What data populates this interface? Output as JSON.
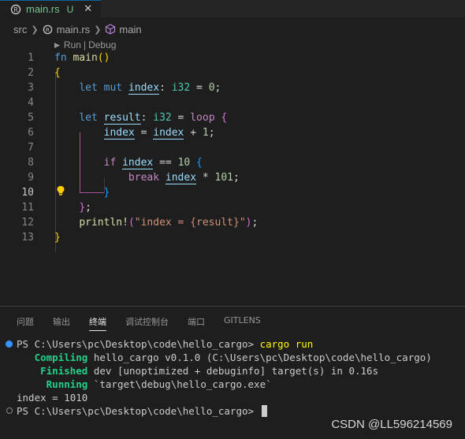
{
  "tab": {
    "filename": "main.rs",
    "status": "U",
    "close": "✕"
  },
  "breadcrumb": {
    "folder": "src",
    "file": "main.rs",
    "symbol": "main"
  },
  "codelens": {
    "run": "Run",
    "separator": "|",
    "debug": "Debug"
  },
  "editor": {
    "active_line": "10",
    "line_numbers": [
      "1",
      "2",
      "3",
      "4",
      "5",
      "6",
      "7",
      "8",
      "9",
      "10",
      "11",
      "12",
      "13"
    ],
    "tokens": {
      "fn_kw": "fn",
      "main": "main",
      "paren": "()",
      "let": "let",
      "mut": "mut",
      "index": "index",
      "colon": ":",
      "i32": "i32",
      "eq": " = ",
      "zero": "0",
      "semi": ";",
      "result": "result",
      "loop": "loop",
      "plus": " + ",
      "one": "1",
      "if": "if",
      "eqeq": " == ",
      "ten": "10",
      "break": "break",
      "times": " * ",
      "n101": "101",
      "println": "println!",
      "fmt_str": "\"index = {result}\"",
      "lbrace": "{",
      "rbrace": "}",
      "rbrace_semi": "};",
      "lparen": "(",
      "rparen": ")"
    }
  },
  "panel": {
    "tabs": [
      "问题",
      "输出",
      "终端",
      "调试控制台",
      "端口",
      "GITLENS"
    ],
    "active_tab": "终端"
  },
  "terminal": {
    "prompt1": "PS C:\\Users\\pc\\Desktop\\code\\hello_cargo>",
    "command1": "cargo run",
    "compiling_label": "Compiling",
    "compiling_text": "hello_cargo v0.1.0 (C:\\Users\\pc\\Desktop\\code\\hello_cargo)",
    "finished_label": "Finished",
    "finished_text": "dev [unoptimized + debuginfo] target(s) in 0.16s",
    "running_label": "Running",
    "running_text": "`target\\debug\\hello_cargo.exe`",
    "output": "index = 1010",
    "prompt2": "PS C:\\Users\\pc\\Desktop\\code\\hello_cargo>"
  },
  "watermark": "CSDN @LL596214569",
  "colors": {
    "accent": "#0e639c",
    "untracked": "#73c991",
    "success_dot": "#3794ff"
  }
}
